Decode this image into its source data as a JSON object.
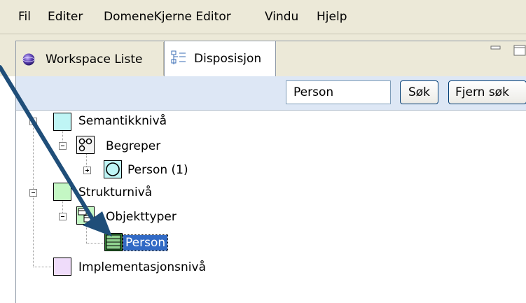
{
  "menubar": {
    "items": [
      {
        "label": "Fil"
      },
      {
        "label": "Editer"
      },
      {
        "label": "DomeneKjerne Editor"
      },
      {
        "label": "Vindu"
      },
      {
        "label": "Hjelp"
      }
    ]
  },
  "tabs": {
    "workspace": {
      "label": "Workspace Liste",
      "icon": "globe-icon"
    },
    "disposisjon": {
      "label": "Disposisjon",
      "icon": "outline-icon",
      "active": true
    }
  },
  "search": {
    "value": "Person",
    "search_button": "Søk",
    "clear_button": "Fjern søk"
  },
  "tree": {
    "semantic": {
      "label": "Semantikknivå",
      "color": "#bff5f5",
      "expanded": true
    },
    "concepts": {
      "label": "Begreper",
      "expanded": true
    },
    "concept_person": {
      "label": "Person (1)",
      "expanded": false
    },
    "structure": {
      "label": "Strukturnivå",
      "color": "#c4f7c4",
      "expanded": true
    },
    "object_types": {
      "label": "Objekttyper",
      "expanded": true
    },
    "object_person": {
      "label": "Person",
      "selected": true
    },
    "implementation": {
      "label": "Implementasjonsnivå",
      "color": "#efdcfa"
    }
  },
  "colors": {
    "chrome": "#ece9d8",
    "toolbar": "#dde7f5",
    "selection": "#316ac5",
    "arrow": "#1f4e79"
  }
}
